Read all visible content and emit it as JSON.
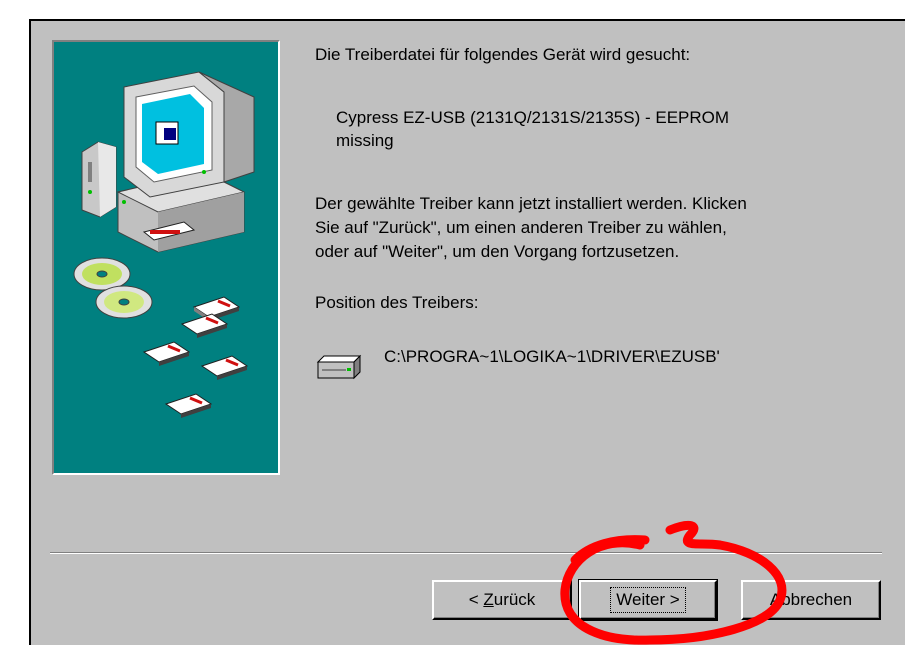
{
  "wizard": {
    "search_heading": "Die Treiberdatei für folgendes Gerät wird gesucht:",
    "device_name_line1": "Cypress EZ-USB (2131Q/2131S/2135S) - EEPROM",
    "device_name_line2": "missing",
    "info_line1": "Der gewählte Treiber kann jetzt installiert werden. Klicken",
    "info_line2": "Sie auf \"Zurück\", um einen anderen Treiber zu wählen,",
    "info_line3": "oder auf \"Weiter\", um den Vorgang fortzusetzen.",
    "driver_location_label": "Position des Treibers:",
    "driver_path": "C:\\PROGRA~1\\LOGIKA~1\\DRIVER\\EZUSB'",
    "drive_icon": "hard-drive-icon",
    "illustration_icon": "computer-with-disks-illustration"
  },
  "buttons": {
    "back_prefix": "< ",
    "back_mnemonic": "Z",
    "back_rest": "urück",
    "next_label": "Weiter >",
    "cancel_label": "Abbrechen"
  },
  "colors": {
    "dialog_face": "#c0c0c0",
    "illustration_bg": "#008080",
    "annotation_red": "#ff0000"
  }
}
